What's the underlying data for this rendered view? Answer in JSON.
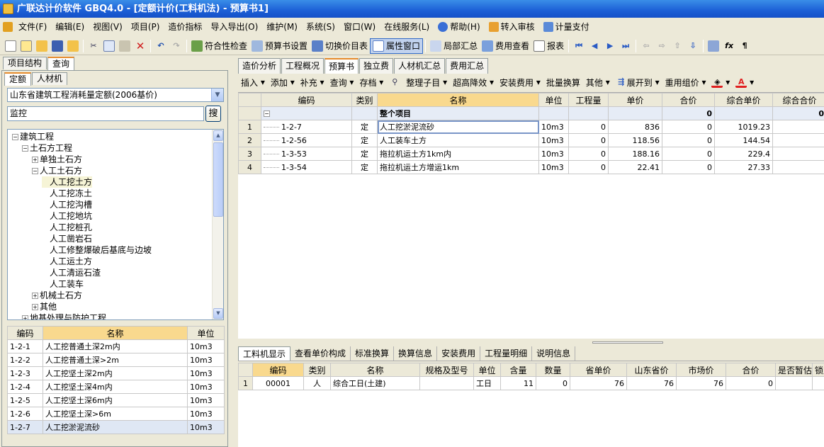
{
  "window": {
    "title": "广联达计价软件 GBQ4.0 - [定额计价(工料机法) - 预算书1]"
  },
  "menu": [
    "文件(F)",
    "编辑(E)",
    "视图(V)",
    "项目(P)",
    "造价指标",
    "导入导出(O)",
    "维护(M)",
    "系统(S)",
    "窗口(W)",
    "在线服务(L)",
    "帮助(H)",
    "转入审核",
    "计量支付"
  ],
  "toolbar": {
    "compliance": "符合性检查",
    "budget_settings": "预算书设置",
    "switch_price": "切换价目表",
    "property_window": "属性窗口",
    "local_summary": "局部汇总",
    "fee_view": "费用查看",
    "report": "报表"
  },
  "left": {
    "tabs": [
      "项目结构",
      "查询"
    ],
    "subtabs": [
      "定额",
      "人材机"
    ],
    "quota_lib": "山东省建筑工程消耗量定额(2006基价)",
    "search_value": "监控",
    "search_button": "搜",
    "tree": [
      {
        "label": "建筑工程",
        "box": "-",
        "depth": 0
      },
      {
        "label": "土石方工程",
        "box": "-",
        "depth": 1
      },
      {
        "label": "单独土石方",
        "box": "+",
        "depth": 2
      },
      {
        "label": "人工土石方",
        "box": "-",
        "depth": 2
      },
      {
        "label": "人工挖土方",
        "box": "",
        "depth": 3,
        "selected": true
      },
      {
        "label": "人工挖冻土",
        "box": "",
        "depth": 3
      },
      {
        "label": "人工挖沟槽",
        "box": "",
        "depth": 3
      },
      {
        "label": "人工挖地坑",
        "box": "",
        "depth": 3
      },
      {
        "label": "人工挖桩孔",
        "box": "",
        "depth": 3
      },
      {
        "label": "人工凿岩石",
        "box": "",
        "depth": 3
      },
      {
        "label": "人工修整爆破后基底与边坡",
        "box": "",
        "depth": 3
      },
      {
        "label": "人工运土方",
        "box": "",
        "depth": 3
      },
      {
        "label": "人工清运石渣",
        "box": "",
        "depth": 3
      },
      {
        "label": "人工装车",
        "box": "",
        "depth": 3
      },
      {
        "label": "机械土石方",
        "box": "+",
        "depth": 2
      },
      {
        "label": "其他",
        "box": "+",
        "depth": 2
      },
      {
        "label": "地基处理与防护工程",
        "box": "+",
        "depth": 1
      }
    ],
    "list_headers": [
      "编码",
      "名称",
      "单位"
    ],
    "list_rows": [
      [
        "1-2-1",
        "人工挖普通土深2m内",
        "10m3"
      ],
      [
        "1-2-2",
        "人工挖普通土深>2m",
        "10m3"
      ],
      [
        "1-2-3",
        "人工挖坚土深2m内",
        "10m3"
      ],
      [
        "1-2-4",
        "人工挖坚土深4m内",
        "10m3"
      ],
      [
        "1-2-5",
        "人工挖坚土深6m内",
        "10m3"
      ],
      [
        "1-2-6",
        "人工挖坚土深>6m",
        "10m3"
      ],
      [
        "1-2-7",
        "人工挖淤泥流砂",
        "10m3"
      ]
    ]
  },
  "right": {
    "tabs": [
      "造价分析",
      "工程概况",
      "预算书",
      "独立费",
      "人材机汇总",
      "费用汇总"
    ],
    "commands": [
      "插入",
      "添加",
      "补充",
      "查询",
      "存档",
      "整理子目",
      "超高降效",
      "安装费用",
      "批量换算",
      "其他",
      "展开到",
      "重用组价"
    ],
    "grid_headers": [
      "编码",
      "类别",
      "名称",
      "单位",
      "工程量",
      "单价",
      "合价",
      "综合单价",
      "综合合价"
    ],
    "group_row": {
      "name": "整个项目",
      "total": "0",
      "comp_total": "0"
    },
    "grid_rows": [
      [
        "1",
        "1-2-7",
        "定",
        "人工挖淤泥流砂",
        "10m3",
        "0",
        "836",
        "0",
        "1019.23"
      ],
      [
        "2",
        "1-2-56",
        "定",
        "人工装车土方",
        "10m3",
        "0",
        "118.56",
        "0",
        "144.54"
      ],
      [
        "3",
        "1-3-53",
        "定",
        "拖拉机运土方1km内",
        "10m3",
        "0",
        "188.16",
        "0",
        "229.4"
      ],
      [
        "4",
        "1-3-54",
        "定",
        "拖拉机运土方增运1km",
        "10m3",
        "0",
        "22.41",
        "0",
        "27.33"
      ]
    ],
    "bottom_tabs": [
      "工料机显示",
      "查看单价构成",
      "标准换算",
      "换算信息",
      "安装费用",
      "工程量明细",
      "说明信息"
    ],
    "bottom_headers": [
      "编码",
      "类别",
      "名称",
      "规格及型号",
      "单位",
      "含量",
      "数量",
      "省单价",
      "山东省价",
      "市场价",
      "合价",
      "是否暂估",
      "锁定"
    ],
    "bottom_rows": [
      [
        "1",
        "00001",
        "人",
        "综合工日(土建)",
        "",
        "工日",
        "11",
        "0",
        "76",
        "76",
        "76",
        "0",
        ""
      ]
    ]
  }
}
